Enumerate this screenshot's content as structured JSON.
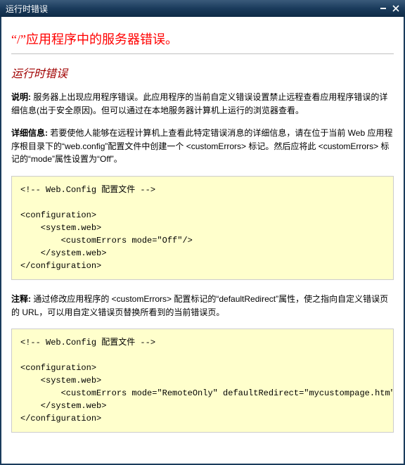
{
  "window": {
    "title": "运行时错误",
    "minimize_label": "minimize",
    "close_label": "close"
  },
  "page": {
    "h1": "“/”应用程序中的服务器错误。",
    "h2": "运行时错误",
    "desc": {
      "label": "说明:",
      "text": " 服务器上出现应用程序错误。此应用程序的当前自定义错误设置禁止远程查看应用程序错误的详细信息(出于安全原因)。但可以通过在本地服务器计算机上运行的浏览器查看。"
    },
    "details": {
      "label": "详细信息:",
      "text": " 若要使他人能够在远程计算机上查看此特定错误消息的详细信息，请在位于当前 Web 应用程序根目录下的“web.config”配置文件中创建一个 <customErrors> 标记。然后应将此 <customErrors> 标记的“mode”属性设置为“Off”。"
    },
    "code1": "<!-- Web.Config 配置文件 -->\n\n<configuration>\n    <system.web>\n        <customErrors mode=\"Off\"/>\n    </system.web>\n</configuration>",
    "notes": {
      "label": "注释:",
      "text": " 通过修改应用程序的 <customErrors> 配置标记的“defaultRedirect”属性，使之指向自定义错误页的 URL，可以用自定义错误页替换所看到的当前错误页。"
    },
    "code2": "<!-- Web.Config 配置文件 -->\n\n<configuration>\n    <system.web>\n        <customErrors mode=\"RemoteOnly\" defaultRedirect=\"mycustompage.htm\"/>\n    </system.web>\n</configuration>"
  }
}
